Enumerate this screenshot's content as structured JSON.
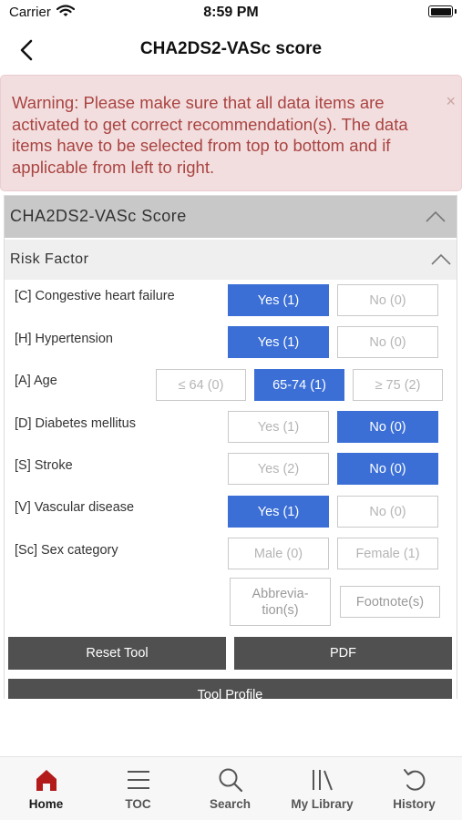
{
  "status_bar": {
    "carrier": "Carrier",
    "time": "8:59 PM"
  },
  "nav": {
    "title": "CHA2DS2-VASc score",
    "back_icon": "chevron-left-icon"
  },
  "warning": {
    "lead": "Warning:",
    "message": "Please make sure that all data items are activated to get correct recommendation(s). The data items have to be selected from top to bottom and if applicable from left to right.",
    "close": "×"
  },
  "tool": {
    "title": "CHA2DS2-VASc Score",
    "section": "Risk Factor",
    "rows": [
      {
        "label": "[C] Congestive heart failure",
        "options": [
          "Yes (1)",
          "No (0)"
        ],
        "selected": "Yes (1)"
      },
      {
        "label": "[H] Hypertension",
        "options": [
          "Yes (1)",
          "No (0)"
        ],
        "selected": "Yes (1)"
      },
      {
        "label": "[A] Age",
        "options": [
          "≤ 64 (0)",
          "65-74 (1)",
          "≥ 75 (2)"
        ],
        "selected": "65-74 (1)"
      },
      {
        "label": "[D] Diabetes mellitus",
        "options": [
          "Yes (1)",
          "No (0)"
        ],
        "selected": "No (0)"
      },
      {
        "label": "[S] Stroke",
        "options": [
          "Yes (2)",
          "No (0)"
        ],
        "selected": "No (0)"
      },
      {
        "label": "[V] Vascular disease",
        "options": [
          "Yes (1)",
          "No (0)"
        ],
        "selected": "Yes (1)"
      },
      {
        "label": "[Sc] Sex category",
        "options": [
          "Male (0)",
          "Female (1)"
        ],
        "selected": null
      }
    ],
    "abbreviations": "Abbrevia-tion(s)",
    "footnotes": "Footnote(s)",
    "reset": "Reset Tool",
    "pdf": "PDF",
    "profile": "Tool Profile"
  },
  "tabs": [
    {
      "label": "Home",
      "icon": "home-icon",
      "active": true
    },
    {
      "label": "TOC",
      "icon": "list-icon",
      "active": false
    },
    {
      "label": "Search",
      "icon": "search-icon",
      "active": false
    },
    {
      "label": "My Library",
      "icon": "library-icon",
      "active": false
    },
    {
      "label": "History",
      "icon": "history-icon",
      "active": false
    }
  ],
  "colors": {
    "selected": "#3b6fd6",
    "warning_bg": "#f2dede",
    "warning_text": "#a94442",
    "home_active": "#b31b1b"
  }
}
